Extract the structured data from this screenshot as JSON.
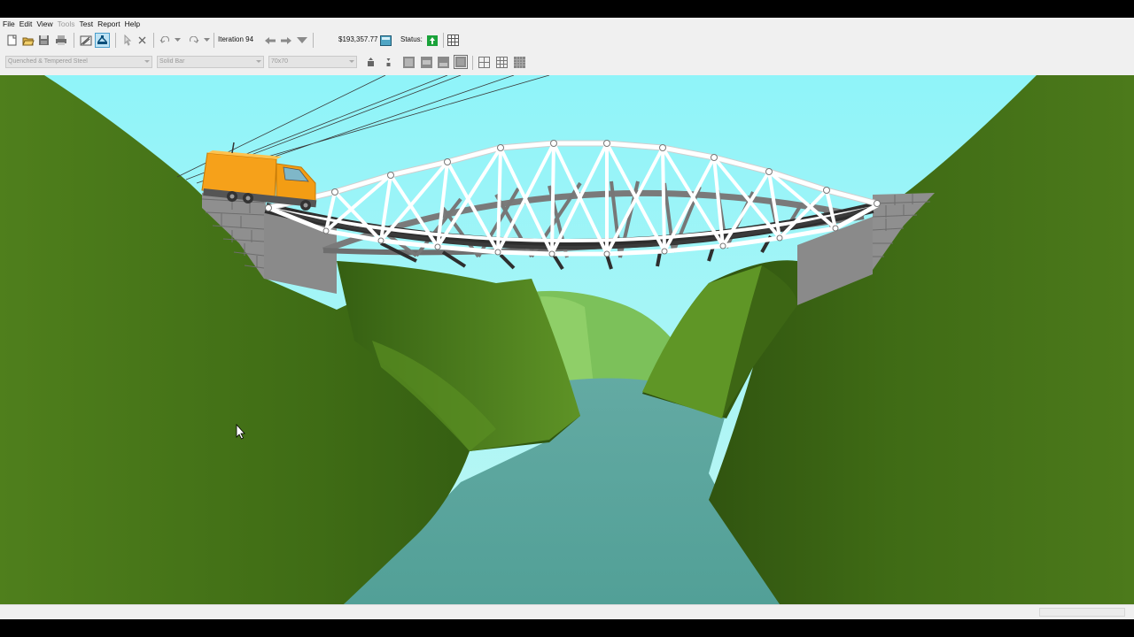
{
  "menu": {
    "file": "File",
    "edit": "Edit",
    "view": "View",
    "tools": "Tools",
    "test": "Test",
    "report": "Report",
    "help": "Help"
  },
  "toolbar": {
    "iteration_label": "Iteration 94",
    "cost": "$193,357.77",
    "status_label": "Status:"
  },
  "member_bar": {
    "material": "Quenched & Tempered Steel",
    "section": "Solid Bar",
    "size": "70x70"
  },
  "colors": {
    "sky": "#8ff4f9",
    "hill_dark": "#3e6a14",
    "hill_light": "#5e9224",
    "river": "#5aa39c",
    "truss": "#ffffff",
    "truck_body": "#f6a11a",
    "status_ok": "#1aa23a"
  }
}
